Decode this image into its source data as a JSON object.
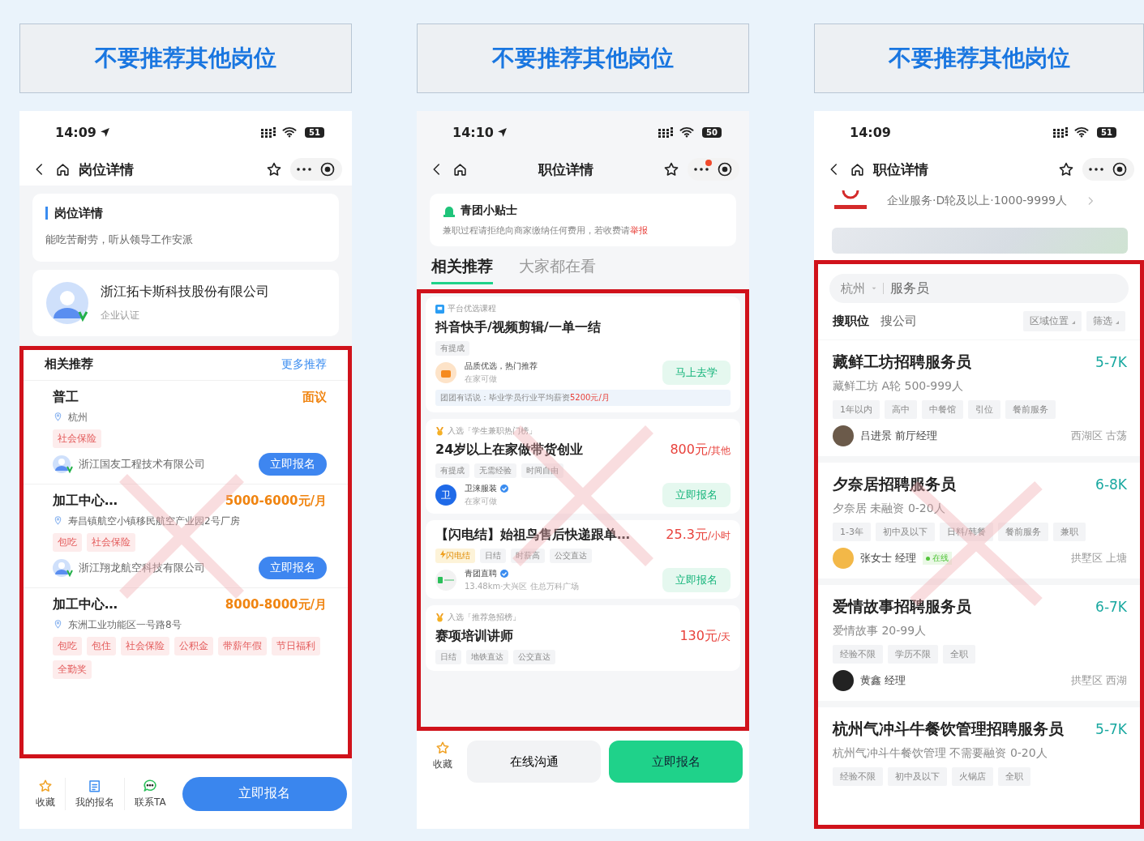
{
  "panels": [
    {
      "kind": "detail",
      "header": "不要推荐其他岗位",
      "status": {
        "time": "14:09",
        "location": true,
        "battery": "51"
      },
      "nav": {
        "title": "岗位详情",
        "menu_badge": false
      },
      "detail": {
        "heading": "岗位详情",
        "text": "能吃苦耐劳，听从领导工作安派"
      },
      "company": {
        "name": "浙江拓卡斯科技股份有限公司",
        "badge": "企业认证"
      },
      "recommend": {
        "title": "相关推荐",
        "more": "更多推荐",
        "jobs": [
          {
            "title": "普工",
            "salary": "面议",
            "location": "杭州",
            "tags": [
              "社会保险"
            ],
            "company": "浙江国友工程技术有限公司",
            "button": "立即报名"
          },
          {
            "title": "加工中心…",
            "salary": "5000-6000元/月",
            "location": "寿昌镇航空小镇移民航空产业园2号厂房",
            "tags": [
              "包吃",
              "社会保险"
            ],
            "company": "浙江翔龙航空科技有限公司",
            "button": "立即报名"
          },
          {
            "title": "加工中心…",
            "salary": "8000-8000元/月",
            "location": "东洲工业功能区一号路8号",
            "tags": [
              "包吃",
              "包住",
              "社会保险",
              "公积金",
              "带薪年假",
              "节日福利",
              "全勤奖"
            ]
          }
        ]
      },
      "bottom": {
        "items": [
          {
            "kind": "star",
            "label": "收藏"
          },
          {
            "kind": "form",
            "label": "我的报名"
          },
          {
            "kind": "chat",
            "label": "联系TA"
          }
        ],
        "cta": "立即报名"
      }
    },
    {
      "kind": "tips",
      "header": "不要推荐其他岗位",
      "status": {
        "time": "14:10",
        "location": true,
        "battery": "50"
      },
      "nav": {
        "title": "职位详情",
        "menu_badge": true
      },
      "tips": {
        "title": "青团小贴士",
        "text": "兼职过程请拒绝向商家缴纳任何费用，若收费请",
        "link": "举报"
      },
      "tabs": [
        {
          "label": "相关推荐",
          "selected": true
        },
        {
          "label": "大家都在看",
          "selected": false
        }
      ],
      "cards": [
        {
          "kind": "course",
          "badge": "平台优选课程",
          "title": "抖音快手/视频剪辑/一单一结",
          "tags": [
            {
              "label": "有提成",
              "kind": "plain"
            }
          ],
          "org": "品质优选，热门推荐",
          "org_sub": "在家可做",
          "button": "马上去学",
          "note": "团团有话说：毕业学员行业平均薪资",
          "note_value": "5200元/月"
        },
        {
          "kind": "job",
          "badge": "入选「学生兼职热门榜」",
          "title": "24岁以上在家做带货创业",
          "salary": "800元",
          "unit": "/其他",
          "tags": [
            {
              "label": "有提成",
              "kind": "plain"
            },
            {
              "label": "无需经验",
              "kind": "plain"
            },
            {
              "label": "时间自由",
              "kind": "plain"
            }
          ],
          "avatar": "卫",
          "org": "卫涞服装",
          "org_sub": "在家可做",
          "verified": true,
          "button": "立即报名"
        },
        {
          "kind": "job",
          "title": "【闪电结】始祖鸟售后快递跟单…",
          "salary": "25.3元",
          "unit": "/小时",
          "tags": [
            {
              "label": "闪电结",
              "kind": "flash"
            },
            {
              "label": "日结",
              "kind": "plain"
            },
            {
              "label": "时薪高",
              "kind": "plain"
            },
            {
              "label": "公交直达",
              "kind": "plain"
            }
          ],
          "org": "青团直聘",
          "org_sub": "13.48km·大兴区 住总万科广场",
          "verified": true,
          "button": "立即报名"
        },
        {
          "kind": "job",
          "badge": "入选「推荐急招榜」",
          "title": "赛项培训讲师",
          "salary": "130元",
          "unit": "/天",
          "tags": [
            {
              "label": "日结",
              "kind": "plain"
            },
            {
              "label": "地铁直达",
              "kind": "plain"
            },
            {
              "label": "公交直达",
              "kind": "plain"
            }
          ]
        }
      ],
      "bottom": {
        "fav": "收藏",
        "chat": "在线沟通",
        "cta": "立即报名"
      }
    },
    {
      "kind": "search",
      "header": "不要推荐其他岗位",
      "status": {
        "time": "14:09",
        "location": false,
        "battery": "51"
      },
      "nav": {
        "title": "职位详情",
        "menu_badge": false
      },
      "company": {
        "meta": "企业服务·D轮及以上·1000-9999人"
      },
      "search": {
        "city": "杭州",
        "query": "服务员"
      },
      "search_tabs": [
        {
          "label": "搜职位",
          "selected": true
        },
        {
          "label": "搜公司",
          "selected": false
        }
      ],
      "filters": [
        "区域位置",
        "筛选"
      ],
      "jobs": [
        {
          "title": "藏鲜工坊招聘服务员",
          "salary": "5-7K",
          "company": "藏鲜工坊 A轮 500-999人",
          "tags": [
            "1年以内",
            "高中",
            "中餐馆",
            "引位",
            "餐前服务"
          ],
          "recruiter": "吕进景 前厅经理",
          "online": false,
          "area": "西湖区 古荡"
        },
        {
          "title": "夕奈居招聘服务员",
          "salary": "6-8K",
          "company": "夕奈居 未融资 0-20人",
          "tags": [
            "1-3年",
            "初中及以下",
            "日料/韩餐",
            "餐前服务",
            "兼职"
          ],
          "recruiter": "张女士 经理",
          "online": true,
          "online_label": "在线",
          "area": "拱墅区 上塘"
        },
        {
          "title": "爱情故事招聘服务员",
          "salary": "6-7K",
          "company": "爱情故事 20-99人",
          "tags": [
            "经验不限",
            "学历不限",
            "全职"
          ],
          "recruiter": "黄鑫 经理",
          "online": false,
          "area": "拱墅区 西湖"
        },
        {
          "title": "杭州气冲斗牛餐饮管理招聘服务员",
          "salary": "5-7K",
          "company": "杭州气冲斗牛餐饮管理 不需要融资 0-20人",
          "tags": [
            "经验不限",
            "初中及以下",
            "火锅店",
            "全职"
          ]
        }
      ]
    }
  ]
}
